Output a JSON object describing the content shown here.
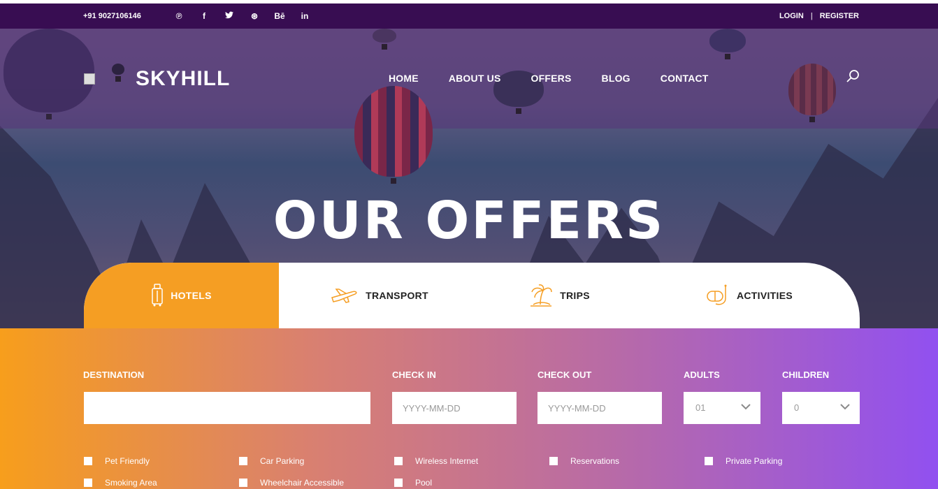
{
  "topbar": {
    "phone": "+91 9027106146",
    "social_icons": [
      {
        "name": "pinterest-icon",
        "glyph": "℗"
      },
      {
        "name": "facebook-icon",
        "glyph": "f"
      },
      {
        "name": "twitter-icon",
        "glyph": "🐦"
      },
      {
        "name": "dribbble-icon",
        "glyph": "⊛"
      },
      {
        "name": "behance-icon",
        "glyph": "Bē"
      },
      {
        "name": "linkedin-icon",
        "glyph": "in"
      }
    ],
    "login": "LOGIN",
    "separator": "|",
    "register": "REGISTER"
  },
  "header": {
    "logo_text": "SKYHILL",
    "nav": [
      "HOME",
      "ABOUT US",
      "OFFERS",
      "BLOG",
      "CONTACT"
    ],
    "search_icon": "search-icon"
  },
  "hero": {
    "title": "OUR OFFERS"
  },
  "tabs": [
    {
      "label": "HOTELS",
      "icon": "luggage-icon",
      "active": true
    },
    {
      "label": "TRANSPORT",
      "icon": "airplane-icon",
      "active": false
    },
    {
      "label": "TRIPS",
      "icon": "palm-island-icon",
      "active": false
    },
    {
      "label": "ACTIVITIES",
      "icon": "snorkel-mask-icon",
      "active": false
    }
  ],
  "search_form": {
    "destination_label": "DESTINATION",
    "destination_value": "",
    "checkin_label": "CHECK IN",
    "checkin_placeholder": "YYYY-MM-DD",
    "checkout_label": "CHECK OUT",
    "checkout_placeholder": "YYYY-MM-DD",
    "adults_label": "ADULTS",
    "adults_value": "01",
    "children_label": "CHILDREN",
    "children_value": "0"
  },
  "amenities": [
    "Pet Friendly",
    "Car Parking",
    "Wireless Internet",
    "Reservations",
    "Private Parking",
    "Smoking Area",
    "Wheelchair Accessible",
    "Pool"
  ],
  "colors": {
    "topbar": "#380d52",
    "accent_orange": "#f59e23",
    "gradient_end_purple": "#9150f0"
  }
}
